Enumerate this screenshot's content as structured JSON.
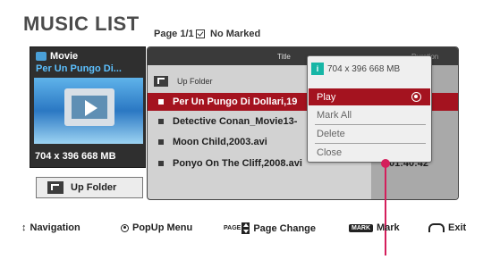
{
  "header": {
    "title": "MUSIC LIST",
    "page_info": "Page 1/1",
    "marked": "No Marked"
  },
  "thumbnail": {
    "category": "Movie",
    "file_name": "Per Un Pungo Di...",
    "resolution_size": "704 x 396  668 MB",
    "up_folder_label": "Up Folder"
  },
  "list": {
    "col_title": "Title",
    "col_duration": "Duration",
    "up_folder": "Up Folder",
    "items": [
      {
        "name": "Per Un Pungo Di Dollari,19",
        "duration": ""
      },
      {
        "name": "Detective Conan_Movie13-",
        "duration": ""
      },
      {
        "name": "Moon Child,2003.avi",
        "duration": ""
      },
      {
        "name": "Ponyo On The Cliff,2008.avi",
        "duration": "01:40:42"
      }
    ]
  },
  "popup": {
    "info": "704 x 396  668 MB",
    "info_icon": "i",
    "items": [
      "Play",
      "Mark All",
      "Delete",
      "Close"
    ]
  },
  "footer": {
    "navigation": "Navigation",
    "popup_menu": "PopUp Menu",
    "page_prefix": "PAGE",
    "page_change": "Page Change",
    "mark_key": "MARK",
    "mark": "Mark",
    "exit": "Exit"
  },
  "colors": {
    "selection": "#a4131f",
    "callout": "#d41f5c",
    "info_icon": "#17b6a6"
  }
}
